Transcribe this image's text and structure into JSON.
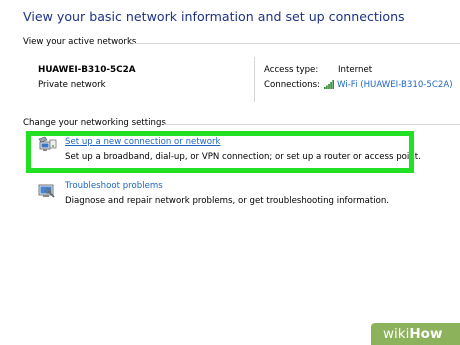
{
  "page_title": "View your basic network information and set up connections",
  "active_networks": {
    "section_label": "View your active networks",
    "network_name": "HUAWEI-B310-5C2A",
    "network_type": "Private network",
    "access_type_label": "Access type:",
    "access_type_value": "Internet",
    "connections_label": "Connections:",
    "connections_value": "Wi-Fi (HUAWEI-B310-5C2A)"
  },
  "networking_settings": {
    "section_label": "Change your networking settings",
    "items": [
      {
        "link": "Set up a new connection or network",
        "description": "Set up a broadband, dial-up, or VPN connection; or set up a router or access point.",
        "icon": "network-setup-icon"
      },
      {
        "link": "Troubleshoot problems",
        "description": "Diagnose and repair network problems, or get troubleshooting information.",
        "icon": "troubleshoot-icon"
      }
    ]
  },
  "watermark": {
    "wiki": "wiki",
    "how": "How"
  },
  "colors": {
    "title": "#1e3287",
    "link": "#1d66c2",
    "highlight": "#22e022",
    "wikihow_badge": "#8cb25c"
  }
}
